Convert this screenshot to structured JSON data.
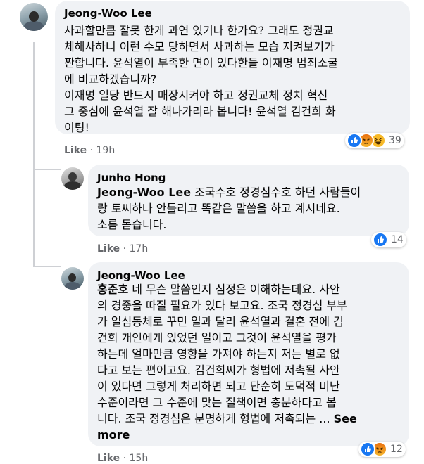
{
  "comments": [
    {
      "author": "Jeong-Woo Lee",
      "lines": [
        "사과할만큼 잘못 한게 과연 있기나 한가요? 그래도 정권교",
        "체해사하니 이런 수모 당하면서 사과하는 모습 지켜보기가",
        "짠합니다. 윤석열이 부족한 면이 있다한들 이재명 범죄소굴",
        "에 비교하겠습니까?",
        "이재명 일당 반드시 매장시켜야 하고 정권교체 정치 혁신",
        "그 중심에 윤석열 잘 해나가리라 봅니다! 윤석열 김건희 화",
        "이팅!"
      ],
      "reaction_icons": [
        "like-icon",
        "angry-icon",
        "haha-icon"
      ],
      "reaction_count": "39",
      "like_label": "Like",
      "separator": "·",
      "time": "19h"
    },
    {
      "author": "Junho Hong",
      "tag": "Jeong-Woo Lee",
      "lines": [
        " 조국수호 정경심수호 하던 사람들이",
        "랑 토씨하나 안틀리고 똑같은 말씀을 하고 계시네요.",
        "소름 돋습니다."
      ],
      "reaction_icons": [
        "like-icon"
      ],
      "reaction_count": "14",
      "like_label": "Like",
      "separator": "·",
      "time": "17h"
    },
    {
      "author": "Jeong-Woo Lee",
      "tag": "홍준호",
      "lines": [
        " 네 무슨 말씀인지 심정은 이해하는데요. 사안",
        "의 경중을 따질 필요가 있다 보고요. 조국 정경심 부부",
        "가 일심동체로 꾸민 일과 달리 윤석열과 결혼 전에 김",
        "건희 개인에게 있었던 일이고 그것이 윤석열을 평가",
        "하는데 얼마만큼 영향을 가져야 하는지 저는 별로 없",
        "다고 보는 편이고요. 김건희씨가 형법에 저촉될 사안",
        "이 있다면 그렇게 처리하면 되고 단순히 도덕적 비난",
        "수준이라면 그 수준에 맞는 질책이면 충분하다고 봅",
        "니다. 조국 정경심은 분명하게 형법에 저촉되는 ... "
      ],
      "see_more_1": "See",
      "see_more_2": "more",
      "reaction_icons": [
        "like-icon",
        "angry-icon"
      ],
      "reaction_count": "12",
      "like_label": "Like",
      "separator": "·",
      "time": "15h"
    }
  ],
  "colors": {
    "bubble": "#f0f2f5",
    "secondary_text": "#65676b",
    "like_blue": "#1877f2",
    "thread_line": "#ced0d4"
  }
}
